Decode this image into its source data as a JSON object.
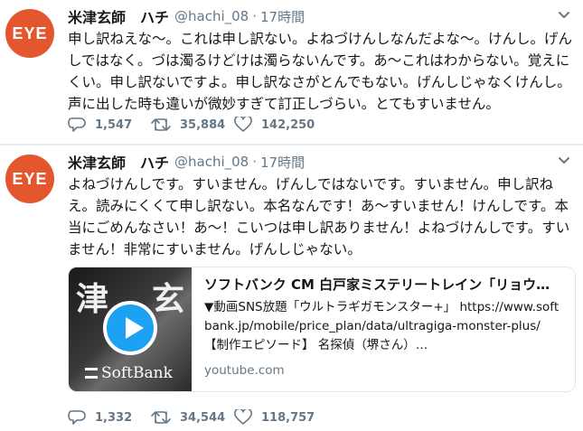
{
  "tweets": [
    {
      "avatar_text": "EYE",
      "name": "米津玄師　ハチ",
      "handle": "@hachi_08",
      "separator": "·",
      "time": "17時間",
      "text": "申し訳ねえな～。これは申し訳ない。よねづけんしなんだよな～。けんし。げんしではなく。づは濁るけどけは濁らないんです。あ～これはわからない。覚えにくい。申し訳ないですよ。申し訳なさがとんでもない。げんしじゃなくけんし。声に出した時も違いが微妙すぎて訂正しづらい。とてもすいません。",
      "reply_count": "1,547",
      "retweet_count": "35,884",
      "like_count": "142,250"
    },
    {
      "avatar_text": "EYE",
      "name": "米津玄師　ハチ",
      "handle": "@hachi_08",
      "separator": "·",
      "time": "17時間",
      "text": "よねづけんしです。すいません。げんしではないです。すいません。申し訳ねえ。読みにくくて申し訳ない。本名なんです！あ～すいません！けんしです。本当にごめんなさい！あ～！こいつは申し訳ありません！よねづけんしです。すいません！非常にすいません。げんしじゃない。",
      "card": {
        "thumb_kanji_left": "津",
        "thumb_kanji_right": "玄",
        "thumb_brand": "SoftBank",
        "title": "ソフトバンク CM 白戸家ミステリートレイン「リョウ…",
        "description": "▼動画SNS放題「ウルトラギガモンスター+」 https://www.softbank.jp/mobile/price_plan/data/ultragiga-monster-plus/ 【制作エピソード】 名探偵（堺さん）…",
        "domain": "youtube.com"
      },
      "reply_count": "1,332",
      "retweet_count": "34,544",
      "like_count": "118,757"
    }
  ],
  "colors": {
    "avatar_bg": "#e4572e",
    "secondary_text": "#657786",
    "play_button": "#1da1f2"
  }
}
